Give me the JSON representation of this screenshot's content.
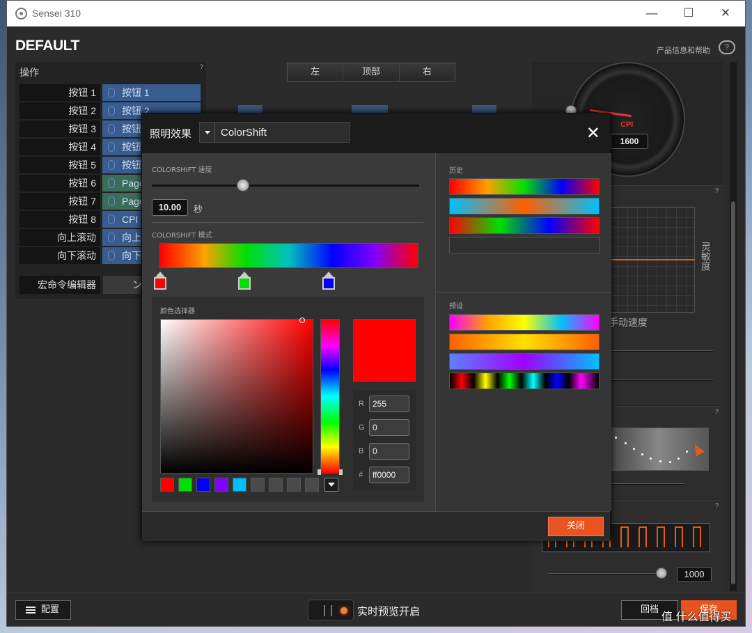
{
  "window": {
    "title": "Sensei 310",
    "controls": {
      "minimize": "—",
      "maximize": "☐",
      "close": "✕"
    }
  },
  "header": {
    "profile_name": "DEFAULT",
    "help_link": "产品信息和帮助"
  },
  "actions": {
    "title": "操作",
    "help": "?",
    "rows": [
      {
        "label": "按钮 1",
        "value": "按钮 1"
      },
      {
        "label": "按钮 2",
        "value": "按钮 2"
      },
      {
        "label": "按钮 3",
        "value": "按钮"
      },
      {
        "label": "按钮 4",
        "value": "按钮"
      },
      {
        "label": "按钮 5",
        "value": "按钮"
      },
      {
        "label": "按钮 6",
        "value": "Page"
      },
      {
        "label": "按钮 7",
        "value": "Page"
      },
      {
        "label": "按钮 8",
        "value": "CPI"
      },
      {
        "label": "向上滚动",
        "value": "向上"
      },
      {
        "label": "向下滚动",
        "value": "向下"
      }
    ],
    "macro": {
      "label": "宏命令编辑器",
      "value": "ン"
    }
  },
  "side_tabs": [
    "左",
    "顶部",
    "右"
  ],
  "right_panel": {
    "cpi_label": "CPI",
    "cpi_value": "1600",
    "sensitivity_label": "灵敏度",
    "manual_speed_label": "手动速度",
    "polling_value": "1000",
    "help": "?"
  },
  "footer": {
    "config_label": "配置",
    "preview_label": "实时预览开启",
    "revert_label": "回档",
    "save_label": "保存"
  },
  "modal": {
    "effect_label": "照明效果",
    "effect_value": "ColorShift",
    "close_icon": "✕",
    "speed_title": "COLORSHIFT 速度",
    "speed_value": "10.00",
    "speed_unit": "秒",
    "speed_level": 0.34,
    "mode_title": "COLORSHIFT 模式",
    "stops": [
      "#ff0000",
      "#00e000",
      "#0000ff"
    ],
    "picker_title": "颜色选择器",
    "rgb": {
      "r_label": "R",
      "r": "255",
      "g_label": "G",
      "g": "0",
      "b_label": "B",
      "b": "0",
      "hex_label": "#",
      "hex": "ff0000"
    },
    "swatches": [
      "#ff0000",
      "#00e000",
      "#0000ff",
      "#8000ff",
      "#00bfff",
      "#4a4a4a",
      "#4a4a4a",
      "#4a4a4a",
      "#4a4a4a"
    ],
    "history_title": "历史",
    "preset_title": "预设",
    "close_button": "关闭"
  },
  "watermark": "值 什么值得买"
}
